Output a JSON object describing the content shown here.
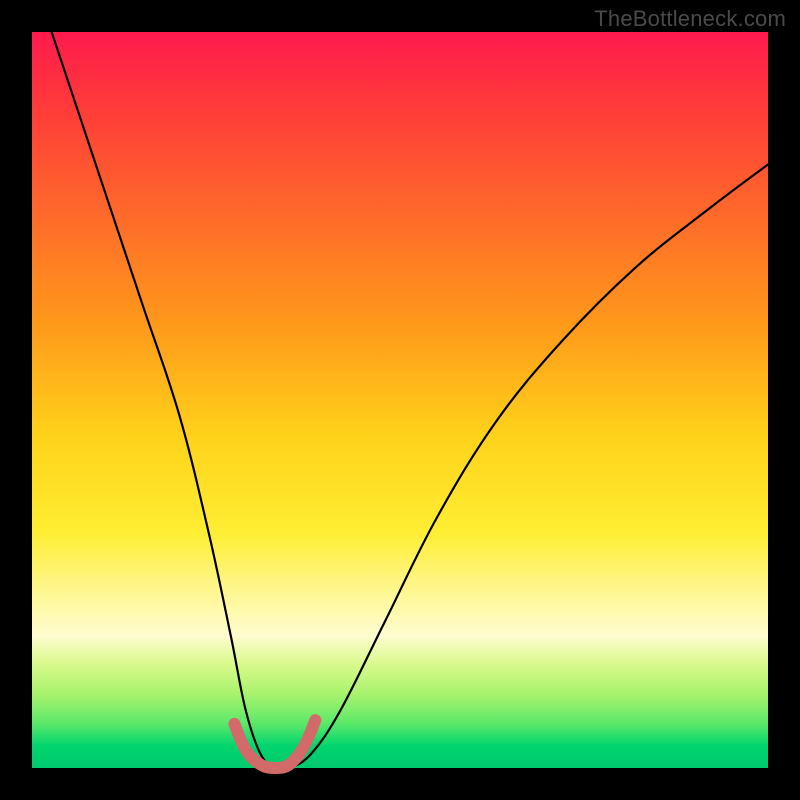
{
  "watermark": "TheBottleneck.com",
  "chart_data": {
    "type": "line",
    "title": "",
    "xlabel": "",
    "ylabel": "",
    "xlim": [
      0,
      100
    ],
    "ylim": [
      0,
      100
    ],
    "series": [
      {
        "name": "curve",
        "x": [
          0,
          5,
          10,
          15,
          20,
          24,
          27,
          29,
          31,
          33,
          35,
          38,
          42,
          48,
          55,
          63,
          72,
          82,
          92,
          100
        ],
        "y": [
          108,
          93,
          78,
          63,
          48,
          32,
          18,
          8,
          2,
          0,
          0,
          2,
          8,
          20,
          34,
          47,
          58,
          68,
          76,
          82
        ]
      }
    ],
    "markers": {
      "name": "dip-highlight",
      "color": "#d36a6a",
      "stroke_width": 12,
      "x": [
        27.5,
        29,
        31,
        33,
        35,
        37,
        38.5
      ],
      "y": [
        6,
        2.5,
        0.5,
        0,
        0.5,
        3,
        6.5
      ]
    },
    "background_gradient": {
      "stops": [
        {
          "pos": 0.0,
          "color": "#ff1a4d"
        },
        {
          "pos": 0.25,
          "color": "#ff6a2a"
        },
        {
          "pos": 0.55,
          "color": "#ffd21a"
        },
        {
          "pos": 0.8,
          "color": "#fffac0"
        },
        {
          "pos": 1.0,
          "color": "#00c96e"
        }
      ]
    }
  }
}
